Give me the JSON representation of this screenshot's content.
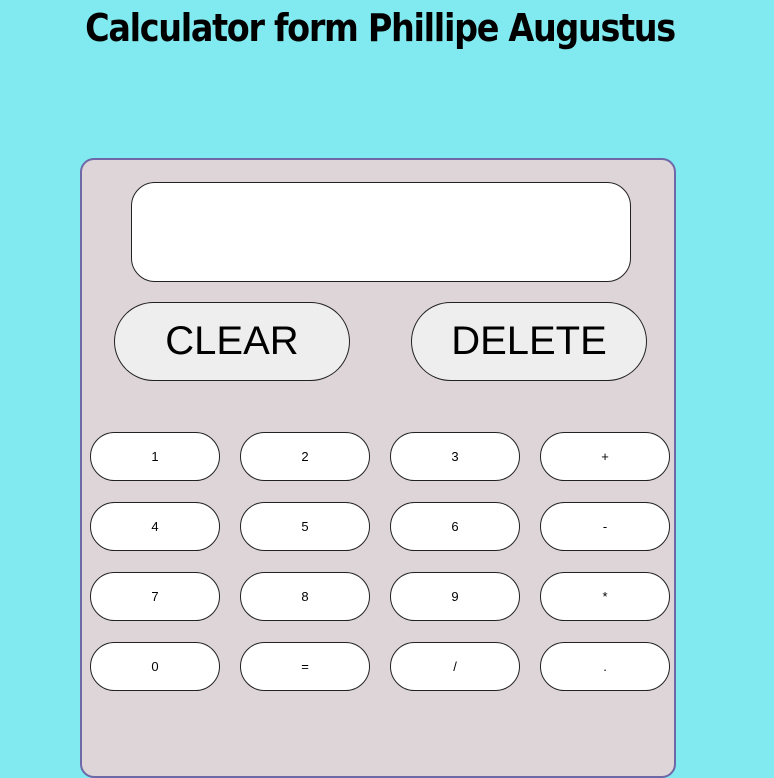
{
  "title": "Calculator form Phillipe Augustus",
  "display": {
    "value": ""
  },
  "controls": {
    "clear_label": "CLEAR",
    "delete_label": "DELETE"
  },
  "keys": [
    [
      "1",
      "2",
      "3",
      "+"
    ],
    [
      "4",
      "5",
      "6",
      "-"
    ],
    [
      "7",
      "8",
      "9",
      "*"
    ],
    [
      "0",
      "=",
      "/",
      "."
    ]
  ],
  "colors": {
    "page_background": "#81e9f0",
    "calculator_body": "#ddd5d7",
    "calculator_border": "#6e68a8",
    "display_background": "#ffffff",
    "control_button_background": "#efeeef",
    "key_background": "#ffffff"
  }
}
